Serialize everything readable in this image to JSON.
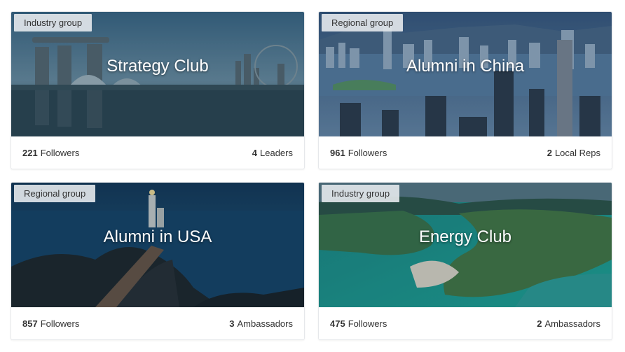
{
  "cards": [
    {
      "badge": "Industry group",
      "title": "Strategy Club",
      "followers_count": "221",
      "followers_label": "Followers",
      "right_count": "4",
      "right_label": "Leaders"
    },
    {
      "badge": "Regional group",
      "title": "Alumni in China",
      "followers_count": "961",
      "followers_label": "Followers",
      "right_count": "2",
      "right_label": "Local Reps"
    },
    {
      "badge": "Regional group",
      "title": "Alumni in USA",
      "followers_count": "857",
      "followers_label": "Followers",
      "right_count": "3",
      "right_label": "Ambassadors"
    },
    {
      "badge": "Industry group",
      "title": "Energy Club",
      "followers_count": "475",
      "followers_label": "Followers",
      "right_count": "2",
      "right_label": "Ambassadors"
    }
  ],
  "colors": {
    "badge_bg": "#e2e6ea",
    "title_text": "#ffffff",
    "footer_text": "#333333"
  }
}
